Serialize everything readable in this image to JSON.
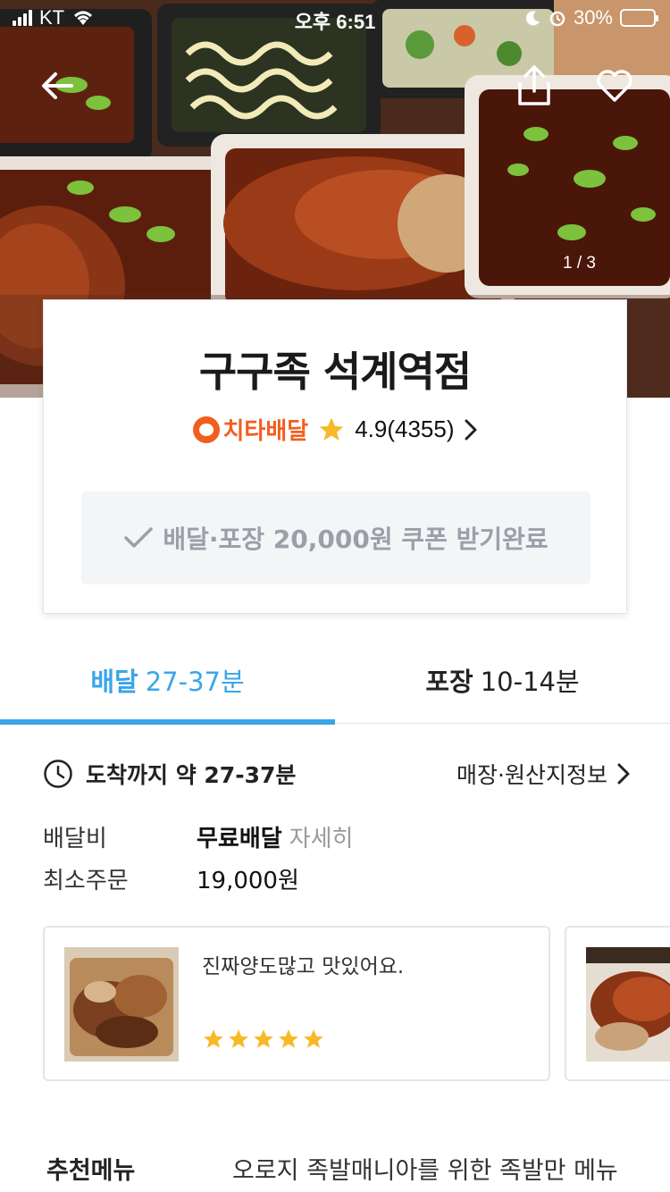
{
  "status_bar": {
    "carrier": "KT",
    "time": "오후 6:51",
    "battery": "30%"
  },
  "hero": {
    "pager": "1 / 3"
  },
  "store": {
    "name": "구구족 석계역점",
    "brand": "치타배달",
    "rating": "4.9(4355)",
    "coupon_text": "배달·포장 20,000원 쿠폰 받기완료"
  },
  "tabs": [
    {
      "label": "배달",
      "time": "27-37분"
    },
    {
      "label": "포장",
      "time": "10-14분"
    }
  ],
  "delivery_info": {
    "arrival": "도착까지 약 27-37분",
    "store_info_link": "매장·원산지정보",
    "fee_label": "배달비",
    "fee_value": "무료배달",
    "fee_detail": "자세히",
    "min_order_label": "최소주문",
    "min_order_value": "19,000원"
  },
  "reviews": [
    {
      "text": "진짜양도많고  맛있어요.",
      "stars": 5
    }
  ],
  "recommend": {
    "title": "추천메뉴",
    "description": "오로지 족발매니아를 위한 족발만 메뉴"
  },
  "colors": {
    "accent": "#3aa5e9",
    "brand": "#f25e1f",
    "star": "#f7b928"
  }
}
